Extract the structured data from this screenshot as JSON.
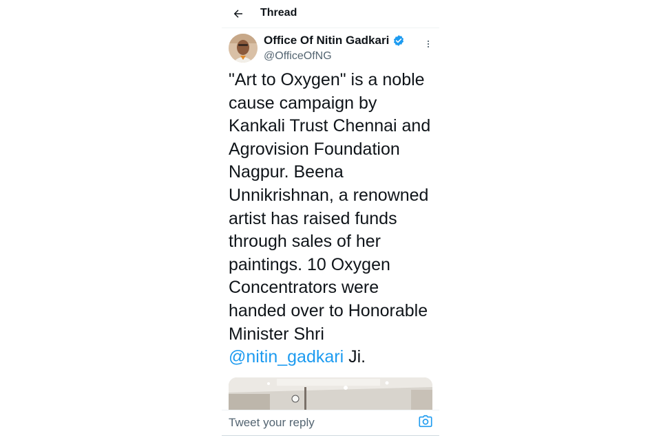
{
  "header": {
    "title": "Thread",
    "back_icon": "arrow-left-icon"
  },
  "tweet": {
    "author_name": "Office Of Nitin Gadkari",
    "handle": "@OfficeOfNG",
    "verified_icon": "verified-badge-icon",
    "more_icon": "more-vertical-icon",
    "text": "\"Art to Oxygen\" is a noble cause campaign by Kankali Trust Chennai and Agrovision Foundation Nagpur. Beena Unnikrishnan, a renowned artist has raised funds through sales of her paintings. 10 Oxygen Concentrators were handed over to Honorable Minister Shri ",
    "mention": "@nitin_gadkari",
    "text_end": " Ji."
  },
  "reply": {
    "placeholder": "Tweet your reply",
    "camera_icon": "camera-icon"
  },
  "colors": {
    "accent": "#1d9bf0",
    "text": "#0f1419",
    "secondary_text": "#536471"
  }
}
